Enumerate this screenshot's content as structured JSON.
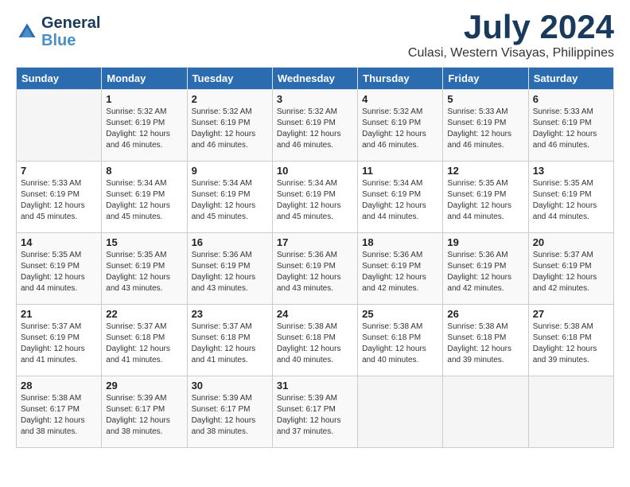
{
  "logo": {
    "text_general": "General",
    "text_blue": "Blue"
  },
  "title": {
    "month_year": "July 2024",
    "location": "Culasi, Western Visayas, Philippines"
  },
  "header": {
    "days": [
      "Sunday",
      "Monday",
      "Tuesday",
      "Wednesday",
      "Thursday",
      "Friday",
      "Saturday"
    ]
  },
  "weeks": [
    {
      "days": [
        {
          "number": "",
          "sunrise": "",
          "sunset": "",
          "daylight": ""
        },
        {
          "number": "1",
          "sunrise": "Sunrise: 5:32 AM",
          "sunset": "Sunset: 6:19 PM",
          "daylight": "Daylight: 12 hours and 46 minutes."
        },
        {
          "number": "2",
          "sunrise": "Sunrise: 5:32 AM",
          "sunset": "Sunset: 6:19 PM",
          "daylight": "Daylight: 12 hours and 46 minutes."
        },
        {
          "number": "3",
          "sunrise": "Sunrise: 5:32 AM",
          "sunset": "Sunset: 6:19 PM",
          "daylight": "Daylight: 12 hours and 46 minutes."
        },
        {
          "number": "4",
          "sunrise": "Sunrise: 5:32 AM",
          "sunset": "Sunset: 6:19 PM",
          "daylight": "Daylight: 12 hours and 46 minutes."
        },
        {
          "number": "5",
          "sunrise": "Sunrise: 5:33 AM",
          "sunset": "Sunset: 6:19 PM",
          "daylight": "Daylight: 12 hours and 46 minutes."
        },
        {
          "number": "6",
          "sunrise": "Sunrise: 5:33 AM",
          "sunset": "Sunset: 6:19 PM",
          "daylight": "Daylight: 12 hours and 46 minutes."
        }
      ]
    },
    {
      "days": [
        {
          "number": "7",
          "sunrise": "Sunrise: 5:33 AM",
          "sunset": "Sunset: 6:19 PM",
          "daylight": "Daylight: 12 hours and 45 minutes."
        },
        {
          "number": "8",
          "sunrise": "Sunrise: 5:34 AM",
          "sunset": "Sunset: 6:19 PM",
          "daylight": "Daylight: 12 hours and 45 minutes."
        },
        {
          "number": "9",
          "sunrise": "Sunrise: 5:34 AM",
          "sunset": "Sunset: 6:19 PM",
          "daylight": "Daylight: 12 hours and 45 minutes."
        },
        {
          "number": "10",
          "sunrise": "Sunrise: 5:34 AM",
          "sunset": "Sunset: 6:19 PM",
          "daylight": "Daylight: 12 hours and 45 minutes."
        },
        {
          "number": "11",
          "sunrise": "Sunrise: 5:34 AM",
          "sunset": "Sunset: 6:19 PM",
          "daylight": "Daylight: 12 hours and 44 minutes."
        },
        {
          "number": "12",
          "sunrise": "Sunrise: 5:35 AM",
          "sunset": "Sunset: 6:19 PM",
          "daylight": "Daylight: 12 hours and 44 minutes."
        },
        {
          "number": "13",
          "sunrise": "Sunrise: 5:35 AM",
          "sunset": "Sunset: 6:19 PM",
          "daylight": "Daylight: 12 hours and 44 minutes."
        }
      ]
    },
    {
      "days": [
        {
          "number": "14",
          "sunrise": "Sunrise: 5:35 AM",
          "sunset": "Sunset: 6:19 PM",
          "daylight": "Daylight: 12 hours and 44 minutes."
        },
        {
          "number": "15",
          "sunrise": "Sunrise: 5:35 AM",
          "sunset": "Sunset: 6:19 PM",
          "daylight": "Daylight: 12 hours and 43 minutes."
        },
        {
          "number": "16",
          "sunrise": "Sunrise: 5:36 AM",
          "sunset": "Sunset: 6:19 PM",
          "daylight": "Daylight: 12 hours and 43 minutes."
        },
        {
          "number": "17",
          "sunrise": "Sunrise: 5:36 AM",
          "sunset": "Sunset: 6:19 PM",
          "daylight": "Daylight: 12 hours and 43 minutes."
        },
        {
          "number": "18",
          "sunrise": "Sunrise: 5:36 AM",
          "sunset": "Sunset: 6:19 PM",
          "daylight": "Daylight: 12 hours and 42 minutes."
        },
        {
          "number": "19",
          "sunrise": "Sunrise: 5:36 AM",
          "sunset": "Sunset: 6:19 PM",
          "daylight": "Daylight: 12 hours and 42 minutes."
        },
        {
          "number": "20",
          "sunrise": "Sunrise: 5:37 AM",
          "sunset": "Sunset: 6:19 PM",
          "daylight": "Daylight: 12 hours and 42 minutes."
        }
      ]
    },
    {
      "days": [
        {
          "number": "21",
          "sunrise": "Sunrise: 5:37 AM",
          "sunset": "Sunset: 6:19 PM",
          "daylight": "Daylight: 12 hours and 41 minutes."
        },
        {
          "number": "22",
          "sunrise": "Sunrise: 5:37 AM",
          "sunset": "Sunset: 6:18 PM",
          "daylight": "Daylight: 12 hours and 41 minutes."
        },
        {
          "number": "23",
          "sunrise": "Sunrise: 5:37 AM",
          "sunset": "Sunset: 6:18 PM",
          "daylight": "Daylight: 12 hours and 41 minutes."
        },
        {
          "number": "24",
          "sunrise": "Sunrise: 5:38 AM",
          "sunset": "Sunset: 6:18 PM",
          "daylight": "Daylight: 12 hours and 40 minutes."
        },
        {
          "number": "25",
          "sunrise": "Sunrise: 5:38 AM",
          "sunset": "Sunset: 6:18 PM",
          "daylight": "Daylight: 12 hours and 40 minutes."
        },
        {
          "number": "26",
          "sunrise": "Sunrise: 5:38 AM",
          "sunset": "Sunset: 6:18 PM",
          "daylight": "Daylight: 12 hours and 39 minutes."
        },
        {
          "number": "27",
          "sunrise": "Sunrise: 5:38 AM",
          "sunset": "Sunset: 6:18 PM",
          "daylight": "Daylight: 12 hours and 39 minutes."
        }
      ]
    },
    {
      "days": [
        {
          "number": "28",
          "sunrise": "Sunrise: 5:38 AM",
          "sunset": "Sunset: 6:17 PM",
          "daylight": "Daylight: 12 hours and 38 minutes."
        },
        {
          "number": "29",
          "sunrise": "Sunrise: 5:39 AM",
          "sunset": "Sunset: 6:17 PM",
          "daylight": "Daylight: 12 hours and 38 minutes."
        },
        {
          "number": "30",
          "sunrise": "Sunrise: 5:39 AM",
          "sunset": "Sunset: 6:17 PM",
          "daylight": "Daylight: 12 hours and 38 minutes."
        },
        {
          "number": "31",
          "sunrise": "Sunrise: 5:39 AM",
          "sunset": "Sunset: 6:17 PM",
          "daylight": "Daylight: 12 hours and 37 minutes."
        },
        {
          "number": "",
          "sunrise": "",
          "sunset": "",
          "daylight": ""
        },
        {
          "number": "",
          "sunrise": "",
          "sunset": "",
          "daylight": ""
        },
        {
          "number": "",
          "sunrise": "",
          "sunset": "",
          "daylight": ""
        }
      ]
    }
  ]
}
